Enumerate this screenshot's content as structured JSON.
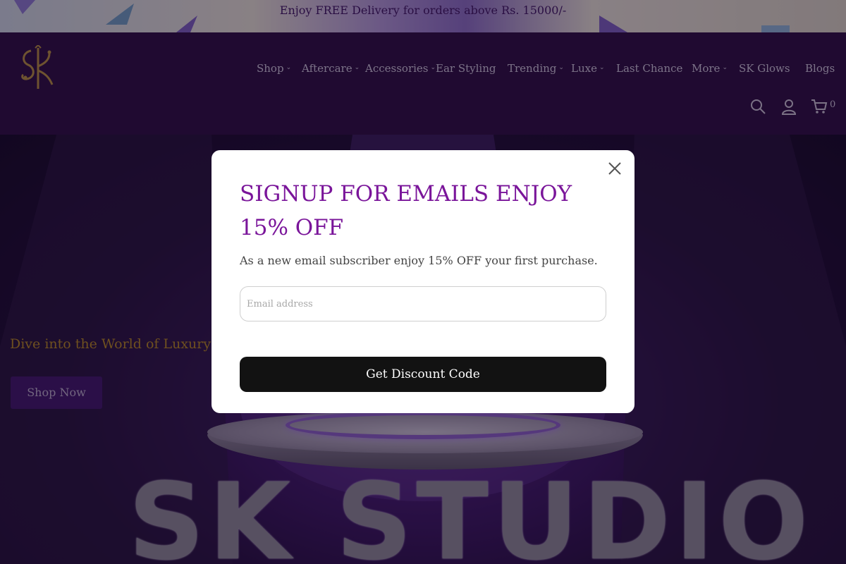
{
  "announcement": {
    "text": "Enjoy FREE Delivery for orders above Rs. 15000/-"
  },
  "header": {
    "nav": [
      {
        "label": "Shop",
        "has_dropdown": true
      },
      {
        "label": "Aftercare",
        "has_dropdown": true
      },
      {
        "label": "Accessories",
        "has_dropdown": true
      },
      {
        "label": "Ear Styling",
        "has_dropdown": false
      },
      {
        "label": "Trending",
        "has_dropdown": true
      },
      {
        "label": "Luxe",
        "has_dropdown": true
      },
      {
        "label": "Last Chance",
        "has_dropdown": false
      },
      {
        "label": "More",
        "has_dropdown": true
      },
      {
        "label": "SK Glows",
        "has_dropdown": false
      },
      {
        "label": "Blogs",
        "has_dropdown": false
      }
    ],
    "chevron": "⌄",
    "icons": [
      "search-icon",
      "account-icon",
      "cart-icon"
    ],
    "cart_count": "0"
  },
  "hero": {
    "tagline": "Dive into the World of Luxury Pierc",
    "cta": "Shop Now",
    "brand_text": "SK STUDIO"
  },
  "modal": {
    "title": "SIGNUP FOR EMAILS ENJOY 15% OFF",
    "subtitle": "As a new email subscriber enjoy 15% OFF your first purchase.",
    "email_placeholder": "Email address",
    "email_value": "",
    "button": "Get Discount Code"
  },
  "colors": {
    "header_bg": "#2a0c3f",
    "announce_text": "#3d1460",
    "modal_title": "#7a159a",
    "hero_tagline": "#b98a1e",
    "cta_bg": "#3e1469",
    "button_bg": "#121212"
  }
}
